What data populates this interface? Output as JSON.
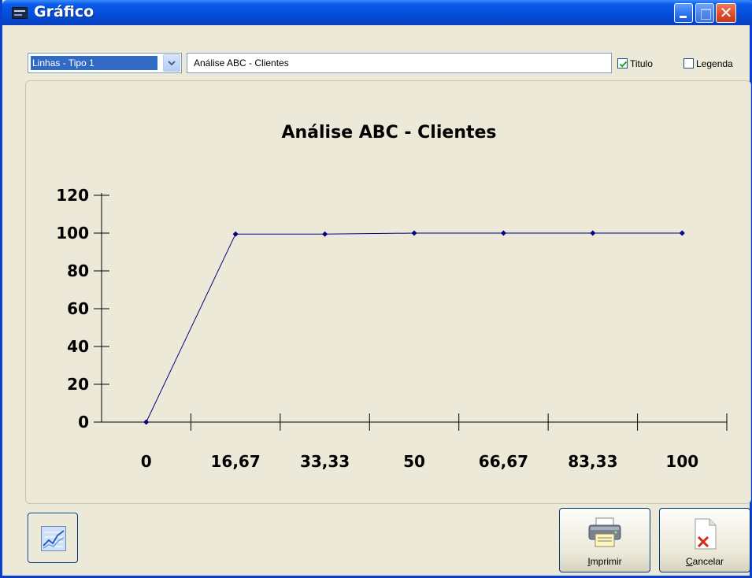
{
  "window": {
    "title": "Gráfico"
  },
  "toolbar": {
    "chart_type_selected": "Linhas - Tipo 1",
    "title_input_value": "Análise ABC - Clientes",
    "titulo_checkbox_label": "Titulo",
    "titulo_checked": true,
    "legenda_checkbox_label": "Legenda",
    "legenda_checked": false
  },
  "buttons": {
    "print_label": "Imprimir",
    "cancel_label": "Cancelar"
  },
  "icons": {
    "app": "app-icon",
    "chart_view": "line-chart-icon",
    "print": "printer-icon",
    "cancel": "cancel-document-icon"
  },
  "colors": {
    "series_line": "#000080",
    "titlebar": "#0550df",
    "panel_bg": "#ece9d8"
  },
  "chart_data": {
    "type": "line",
    "title": "Análise ABC - Clientes",
    "x_tick_labels": [
      "0",
      "16,67",
      "33,33",
      "50",
      "66,67",
      "83,33",
      "100"
    ],
    "y_tick_labels": [
      "0",
      "20",
      "40",
      "60",
      "80",
      "100",
      "120"
    ],
    "ylim": [
      0,
      120
    ],
    "series": [
      {
        "values": [
          0,
          99.5,
          99.5,
          100,
          100,
          100,
          100
        ]
      }
    ],
    "legend": false,
    "grid": false
  }
}
